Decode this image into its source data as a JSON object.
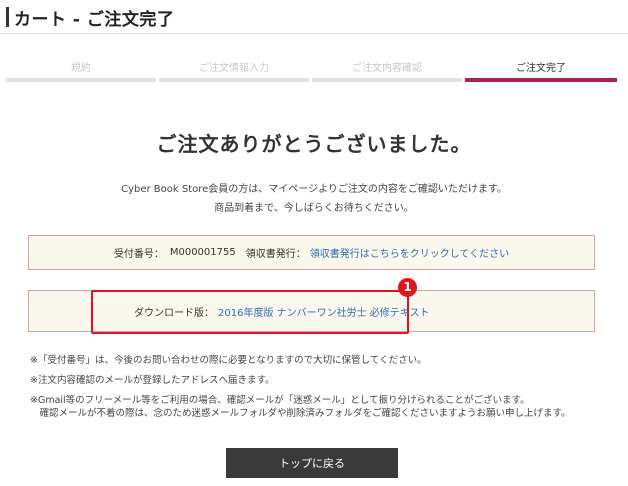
{
  "header": {
    "title": "カート - ご注文完了"
  },
  "steps": [
    {
      "label": "規約"
    },
    {
      "label": "ご注文情報入力"
    },
    {
      "label": "ご注文内容確認"
    },
    {
      "label": "ご注文完了"
    }
  ],
  "main": {
    "thanks": "ご注文ありがとうございました。",
    "info_line1": "Cyber Book Store会員の方は、マイページよりご注文の内容をご確認いただけます。",
    "info_line2": "商品到着まで、今しばらくお待ちください。"
  },
  "order": {
    "number_label": "受付番号：",
    "number_value": "M000001755",
    "receipt_label": "領収書発行：",
    "receipt_link": "領収書発行はこちらをクリックしてください"
  },
  "download": {
    "label": "ダウンロード版：",
    "link": "2016年度版 ナンバーワン社労士 必修テキスト"
  },
  "annotation": {
    "badge": "1"
  },
  "notes": [
    "※「受付番号」は、今後のお問い合わせの際に必要となりますので大切に保管してください。",
    "※注文内容確認のメールが登録したアドレスへ届きます。",
    "※Gmail等のフリーメール等をご利用の場合、確認メールが「迷惑メール」として振り分けられることがございます。",
    "　確認メールが不着の際は、念のため迷惑メールフォルダや削除済みフォルダをご確認くださいますようお願い申し上げます。"
  ],
  "buttons": {
    "top_back": "トップに戻る"
  },
  "colors": {
    "accent": "#a52748",
    "link": "#2a6ebb",
    "highlight": "#e0141c",
    "box_bg": "#faf7ec"
  }
}
